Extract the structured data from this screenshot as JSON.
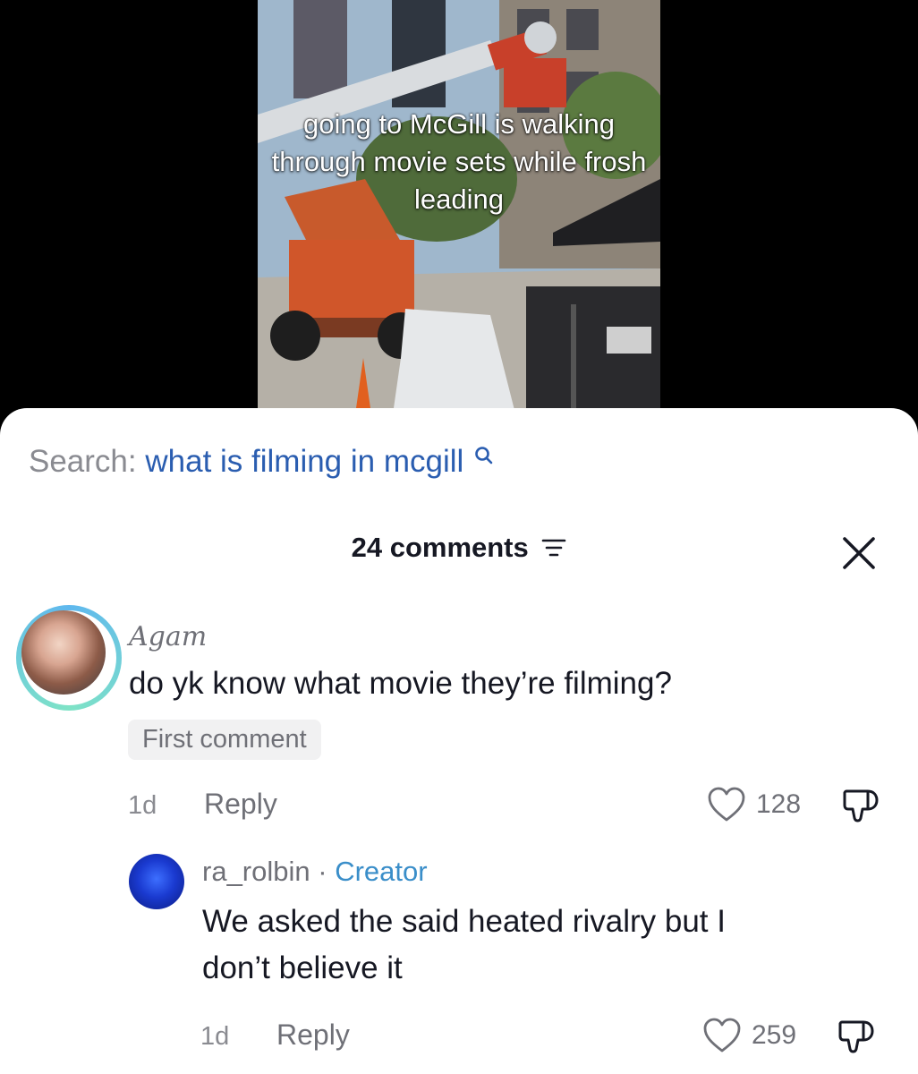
{
  "video": {
    "caption": "going to McGill is walking through movie sets while frosh leading"
  },
  "search": {
    "prefix": "Search:",
    "query": "what is filming in mcgill"
  },
  "comments_header": {
    "count_label": "24 comments"
  },
  "comments": [
    {
      "username": "Agam",
      "text": "do yk know what movie they’re filming?",
      "badge": "First comment",
      "time": "1d",
      "reply_label": "Reply",
      "likes": "128"
    }
  ],
  "replies": [
    {
      "username": "ra_rolbin",
      "separator": "·",
      "role": "Creator",
      "text_line1": "We asked the said heated rivalry but I",
      "text_line2": "don’t believe it",
      "time": "1d",
      "reply_label": "Reply",
      "likes": "259"
    }
  ]
}
